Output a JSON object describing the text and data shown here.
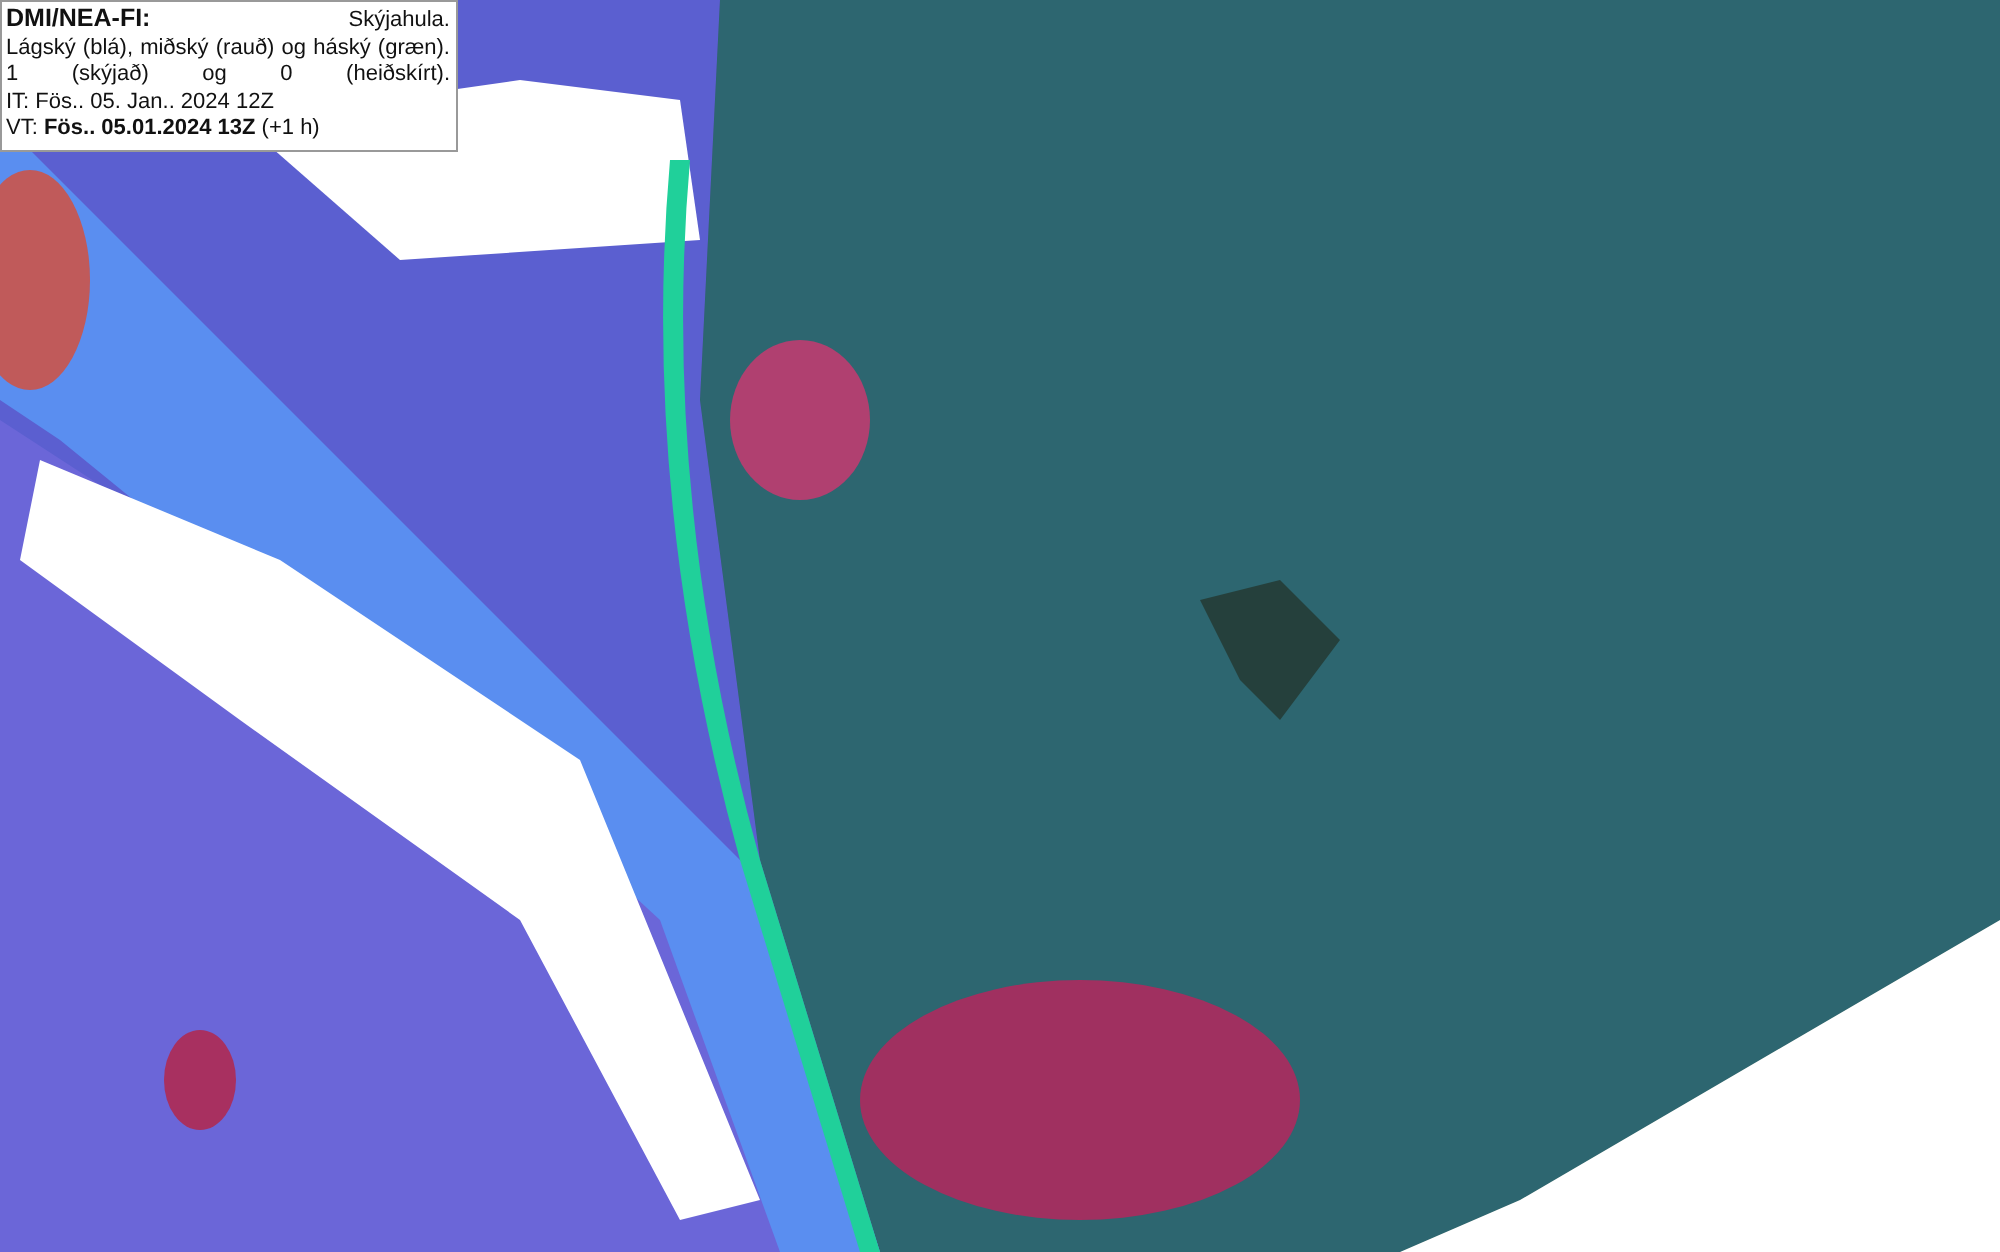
{
  "legend": {
    "source": "DMI/NEA-FI:",
    "product": "Skýjahula.",
    "description": "Lágský (blá), miðský (rauð) og háský (græn). 1 (skýjað) og 0 (heiðskírt).",
    "init_time": "IT: Fös.. 05. Jan.. 2024 12Z",
    "valid_time": "VT: **Fös.. 05.01.2024 13Z** (+1 h)"
  }
}
